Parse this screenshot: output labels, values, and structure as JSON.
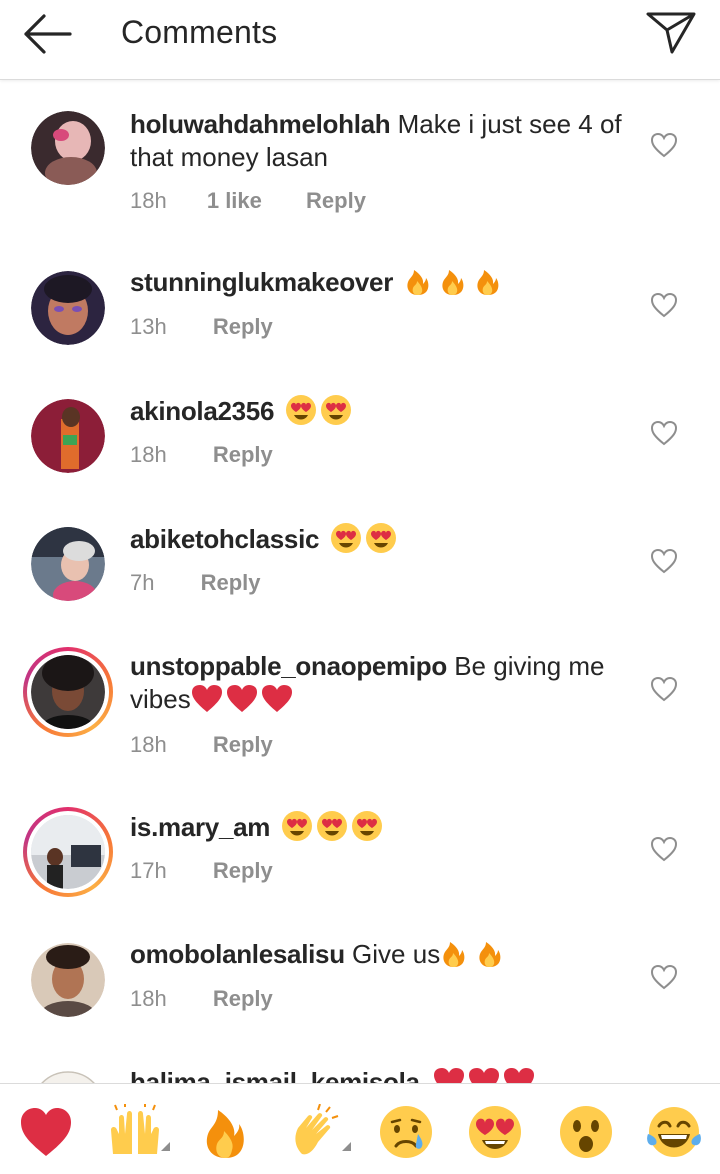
{
  "header": {
    "title": "Comments"
  },
  "comments": [
    {
      "username": "holuwahdahmelohlah",
      "text": "Make i just see 4 of that money lasan",
      "time": "18h",
      "likes": "1 like",
      "reply": "Reply",
      "story": false
    },
    {
      "username": "stunninglukmakeover",
      "text": "",
      "time": "13h",
      "likes": "",
      "reply": "Reply",
      "story": false
    },
    {
      "username": "akinola2356",
      "text": "",
      "time": "18h",
      "likes": "",
      "reply": "Reply",
      "story": false
    },
    {
      "username": "abiketohclassic",
      "text": "",
      "time": "7h",
      "likes": "",
      "reply": "Reply",
      "story": false
    },
    {
      "username": "unstoppable_onaopemipo",
      "text": "Be giving me vibes",
      "time": "18h",
      "likes": "",
      "reply": "Reply",
      "story": true
    },
    {
      "username": "is.mary_am",
      "text": "",
      "time": "17h",
      "likes": "",
      "reply": "Reply",
      "story": true
    },
    {
      "username": "omobolanlesalisu",
      "text": "Give us",
      "time": "18h",
      "likes": "",
      "reply": "Reply",
      "story": false
    },
    {
      "username": "halima_ismail_kemisola",
      "text": "",
      "time": "",
      "likes": "",
      "reply": "",
      "story": false
    }
  ],
  "emoji_bar": [
    "red-heart",
    "raising-hands",
    "fire",
    "clapping-hands",
    "crying-face",
    "heart-eyes-face",
    "astonished-face",
    "tears-of-joy-face"
  ],
  "colors": {
    "text": "#262626",
    "meta": "#8e8e8e",
    "border": "#dbdbdb"
  }
}
